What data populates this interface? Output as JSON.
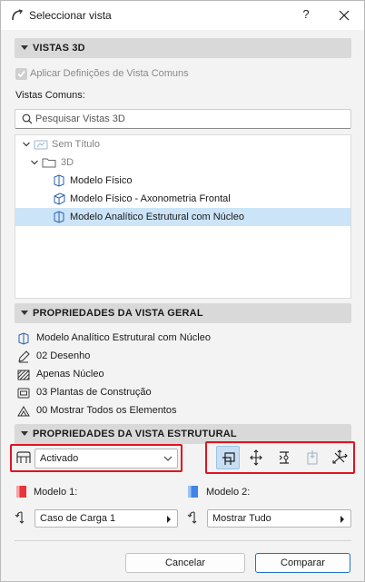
{
  "window": {
    "title": "Seleccionar vista",
    "help_label": "?"
  },
  "sections": {
    "views3d": "VISTAS 3D",
    "general_props": "PROPRIEDADES DA VISTA GERAL",
    "structural_props": "PROPRIEDADES DA VISTA ESTRUTURAL"
  },
  "apply_common": {
    "label": "Aplicar Definições de Vista Comuns",
    "checked": true,
    "disabled": true
  },
  "common_views_label": "Vistas Comuns:",
  "search": {
    "placeholder": "Pesquisar Vistas 3D",
    "value": ""
  },
  "tree": {
    "items": [
      {
        "label": "Sem Título",
        "icon": "untitled-view-icon",
        "expanded": true
      },
      {
        "label": "3D",
        "icon": "folder-icon",
        "expanded": true
      },
      {
        "label": "Modelo Físico",
        "icon": "model-cube-icon"
      },
      {
        "label": "Modelo Físico - Axonometria Frontal",
        "icon": "model-cube-icon"
      },
      {
        "label": "Modelo Analítico Estrutural com Núcleo",
        "icon": "model-cube-icon",
        "selected": true
      }
    ]
  },
  "general_props": [
    {
      "label": "Modelo Analítico Estrutural com Núcleo",
      "icon": "view-cube-icon"
    },
    {
      "label": "02 Desenho",
      "icon": "pen-set-icon"
    },
    {
      "label": "Apenas Núcleo",
      "icon": "hatch-core-icon"
    },
    {
      "label": "03 Plantas de Construção",
      "icon": "model-view-options-icon"
    },
    {
      "label": "00 Mostrar Todos os Elementos",
      "icon": "layer-combination-icon"
    }
  ],
  "structural": {
    "display_select": "Activado",
    "model1_label": "Modelo 1:",
    "model2_label": "Modelo 2:",
    "model1_select": "Caso de Carga 1",
    "model2_select": "Mostrar Tudo",
    "model1_color": "#e8343a",
    "model2_color": "#3f84e6"
  },
  "buttons": {
    "cancel": "Cancelar",
    "compare": "Comparar"
  },
  "colors": {
    "accent": "#1f6fc9",
    "highlight": "#e0141e",
    "selection": "#cce4f7"
  }
}
